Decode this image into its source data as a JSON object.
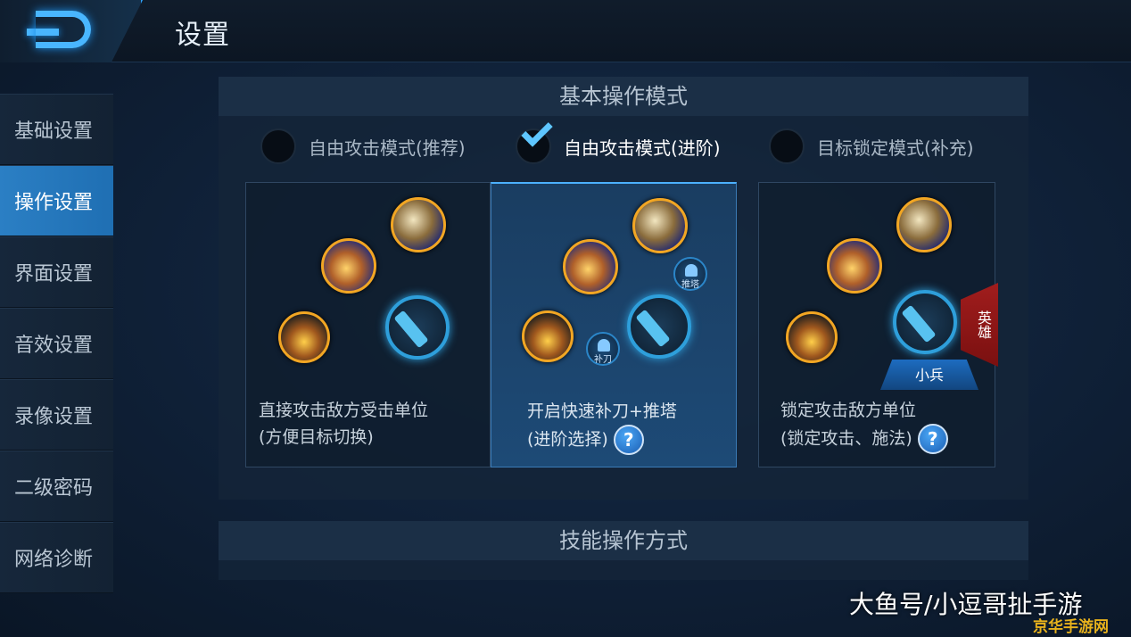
{
  "header": {
    "title": "设置"
  },
  "sidebar": {
    "items": [
      {
        "label": "基础设置"
      },
      {
        "label": "操作设置"
      },
      {
        "label": "界面设置"
      },
      {
        "label": "音效设置"
      },
      {
        "label": "录像设置"
      },
      {
        "label": "二级密码"
      },
      {
        "label": "网络诊断"
      }
    ],
    "active_index": 1
  },
  "basic_mode": {
    "heading": "基本操作模式",
    "options": [
      {
        "label": "自由攻击模式(推荐)",
        "selected": false,
        "desc_line1": "直接攻击敌方受击单位",
        "desc_line2": "(方便目标切换)"
      },
      {
        "label": "自由攻击模式(进阶)",
        "selected": true,
        "desc_line1": "开启快速补刀+推塔",
        "desc_line2": "(进阶选择)",
        "mini_last_hit": "补刀",
        "mini_push": "推塔"
      },
      {
        "label": "目标锁定模式(补充)",
        "selected": false,
        "desc_line1": "锁定攻击敌方单位",
        "desc_line2": "(锁定攻击、施法)",
        "hero_tab": "英雄",
        "minion_tab": "小兵"
      }
    ],
    "help_symbol": "?"
  },
  "skill_mode": {
    "heading": "技能操作方式"
  },
  "watermark": {
    "line1": "大鱼号/小逗哥扯手游",
    "line2": "京华手游网"
  },
  "colors": {
    "accent": "#2b7fc4",
    "gold": "#f2a623"
  }
}
